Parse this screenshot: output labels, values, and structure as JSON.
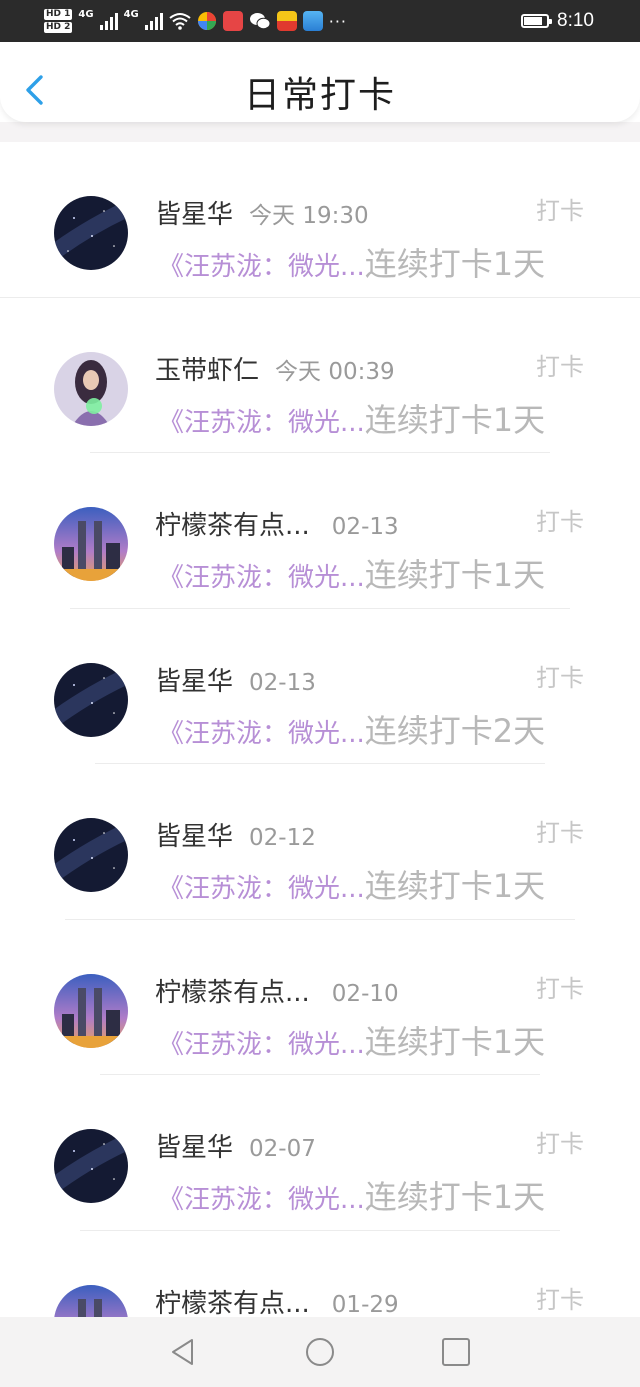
{
  "status_bar": {
    "hd1": "HD 1",
    "hd2": "HD 2",
    "net1": "4G",
    "net2": "4G",
    "more": "···",
    "time": "8:10"
  },
  "header": {
    "title": "日常打卡"
  },
  "colors": {
    "accent": "#2ea0e8",
    "book_title": "#b78fd6",
    "streak_text": "#b8b8b8"
  },
  "feed": [
    {
      "avatar": "night-sky",
      "name": "皆星华",
      "time": "今天 19:30",
      "action": "打卡",
      "book": "《汪苏泷：微光...",
      "streak": "连续打卡1天"
    },
    {
      "avatar": "fantasy-girl",
      "name": "玉带虾仁",
      "time": "今天 00:39",
      "action": "打卡",
      "book": "《汪苏泷：微光...",
      "streak": "连续打卡1天"
    },
    {
      "avatar": "city-night",
      "name": "柠檬茶有点...",
      "time": "02-13",
      "action": "打卡",
      "book": "《汪苏泷：微光...",
      "streak": "连续打卡1天"
    },
    {
      "avatar": "night-sky",
      "name": "皆星华",
      "time": "02-13",
      "action": "打卡",
      "book": "《汪苏泷：微光...",
      "streak": "连续打卡2天"
    },
    {
      "avatar": "night-sky",
      "name": "皆星华",
      "time": "02-12",
      "action": "打卡",
      "book": "《汪苏泷：微光...",
      "streak": "连续打卡1天"
    },
    {
      "avatar": "city-night",
      "name": "柠檬茶有点...",
      "time": "02-10",
      "action": "打卡",
      "book": "《汪苏泷：微光...",
      "streak": "连续打卡1天"
    },
    {
      "avatar": "night-sky",
      "name": "皆星华",
      "time": "02-07",
      "action": "打卡",
      "book": "《汪苏泷：微光...",
      "streak": "连续打卡1天"
    },
    {
      "avatar": "city-night",
      "name": "柠檬茶有点...",
      "time": "01-29",
      "action": "打卡",
      "book": "",
      "streak": ""
    }
  ],
  "nav_bar": {
    "back_icon": "triangle-back-icon",
    "home_icon": "circle-home-icon",
    "recents_icon": "square-recents-icon"
  }
}
